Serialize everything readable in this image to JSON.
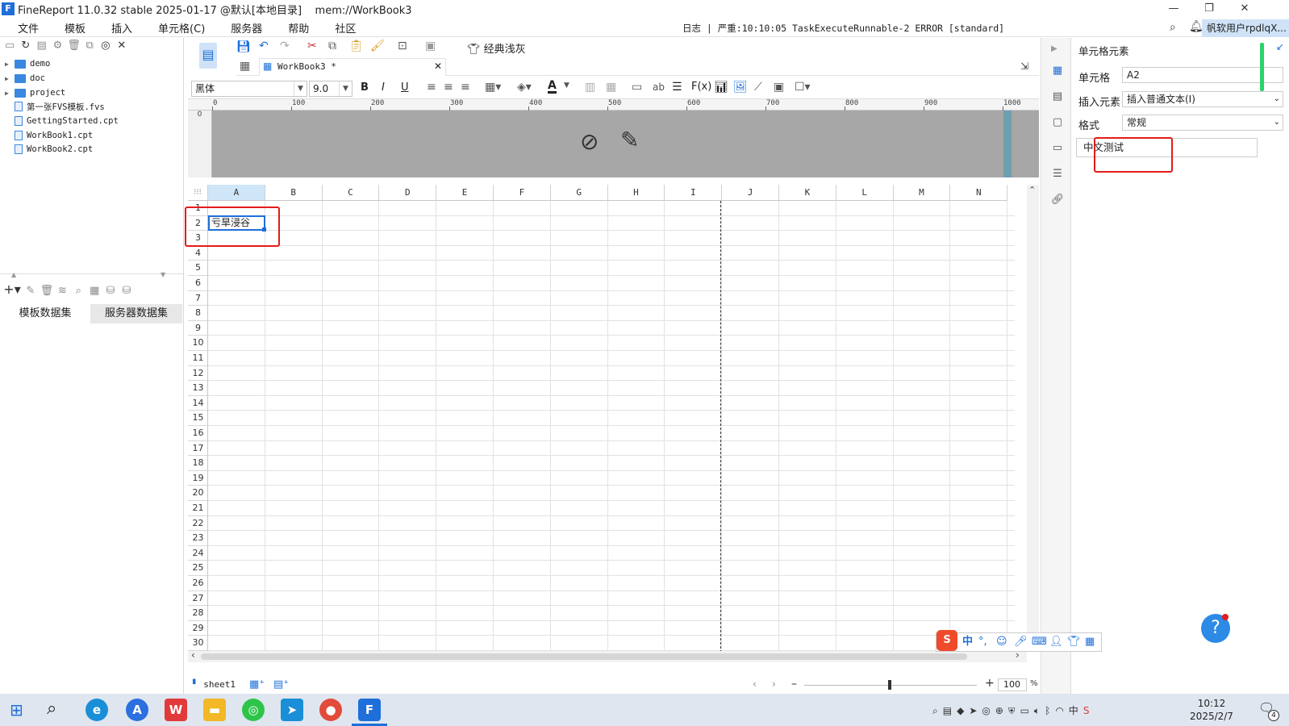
{
  "window": {
    "title": "FineReport 11.0.32 stable 2025-01-17 @默认[本地目录]    mem://WorkBook3"
  },
  "menu": {
    "items": [
      "文件",
      "模板",
      "插入",
      "单元格(C)",
      "服务器",
      "帮助",
      "社区"
    ],
    "log": "日志 | 严重:10:10:05 TaskExecuteRunnable-2 ERROR [standard]",
    "user": "帆软用户rpdlqX..."
  },
  "tree": {
    "items": [
      {
        "label": "demo",
        "type": "folder"
      },
      {
        "label": "doc",
        "type": "folder"
      },
      {
        "label": "project",
        "type": "folder"
      },
      {
        "label": "第一张FVS模板.fvs",
        "type": "file"
      },
      {
        "label": "GettingStarted.cpt",
        "type": "file"
      },
      {
        "label": "WorkBook1.cpt",
        "type": "file"
      },
      {
        "label": "WorkBook2.cpt",
        "type": "file"
      }
    ]
  },
  "dataset_tabs": [
    "模板数据集",
    "服务器数据集"
  ],
  "toolbar": {
    "theme_label": "经典浅灰",
    "tab_label": "WorkBook3 *"
  },
  "format": {
    "font": "黑体",
    "size": "9.0"
  },
  "ruler": {
    "ticks": [
      "0",
      "100",
      "200",
      "300",
      "400",
      "500",
      "600",
      "700",
      "800",
      "900",
      "1000"
    ]
  },
  "grid": {
    "columns": [
      "A",
      "B",
      "C",
      "D",
      "E",
      "F",
      "G",
      "H",
      "I",
      "J",
      "K",
      "L",
      "M",
      "N"
    ],
    "rows": [
      "1",
      "2",
      "3",
      "4",
      "5",
      "6",
      "7",
      "8",
      "9",
      "10",
      "11",
      "12",
      "13",
      "14",
      "15",
      "16",
      "17",
      "18",
      "19",
      "20",
      "21",
      "22",
      "23",
      "24",
      "25",
      "26",
      "27",
      "28",
      "29",
      "30"
    ],
    "cell_a2": "亏旱浸谷",
    "selected_column": "A"
  },
  "sheet": {
    "name": "sheet1",
    "zoom": "100"
  },
  "properties": {
    "header": "单元格元素",
    "cell_label": "单元格",
    "cell_value": "A2",
    "insert_label": "插入元素",
    "insert_value": "插入普通文本(I)",
    "format_label": "格式",
    "format_value": "常规",
    "text_value": "中文测试"
  },
  "ime": {
    "mode": "中"
  },
  "taskbar": {
    "time": "10:12",
    "date": "2025/2/7",
    "notif_count": "4"
  },
  "colors": {
    "accent": "#1e6fd9",
    "highlight": "#e31b1b",
    "selected_header": "#cfe6f8"
  }
}
